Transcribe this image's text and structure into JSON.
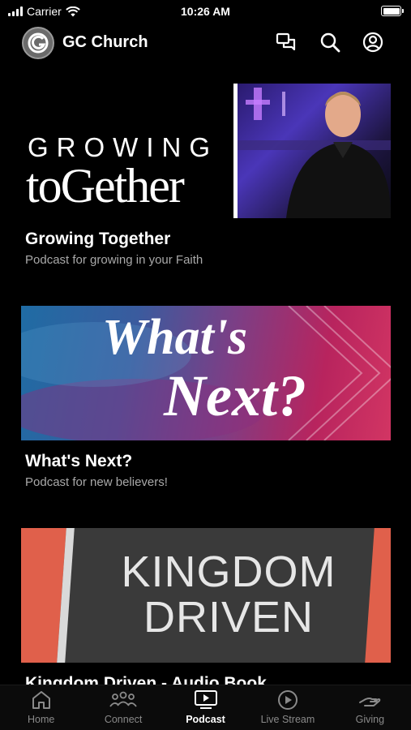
{
  "status": {
    "carrier": "Carrier",
    "time": "10:26 AM"
  },
  "header": {
    "title": "GC Church"
  },
  "podcasts": [
    {
      "title": "Growing Together",
      "subtitle": "Podcast for growing in your Faith",
      "art_line1": "GROWING",
      "art_line2": "toGether"
    },
    {
      "title": "What's Next?",
      "subtitle": "Podcast for new believers!",
      "art_line1": "What's",
      "art_line2": "Next?"
    },
    {
      "title": "Kingdom Driven - Audio Book",
      "art_line1": "KINGDOM",
      "art_line2": "DRIVEN"
    }
  ],
  "tabs": [
    {
      "label": "Home",
      "icon": "home-icon"
    },
    {
      "label": "Connect",
      "icon": "people-icon"
    },
    {
      "label": "Podcast",
      "icon": "podcast-icon",
      "active": true
    },
    {
      "label": "Live Stream",
      "icon": "play-circle-icon"
    },
    {
      "label": "Giving",
      "icon": "giving-hand-icon"
    }
  ],
  "colors": {
    "background": "#000000",
    "subtitle": "#a9a9a9",
    "tab_inactive": "#8a8a8a",
    "tab_active": "#ffffff"
  }
}
